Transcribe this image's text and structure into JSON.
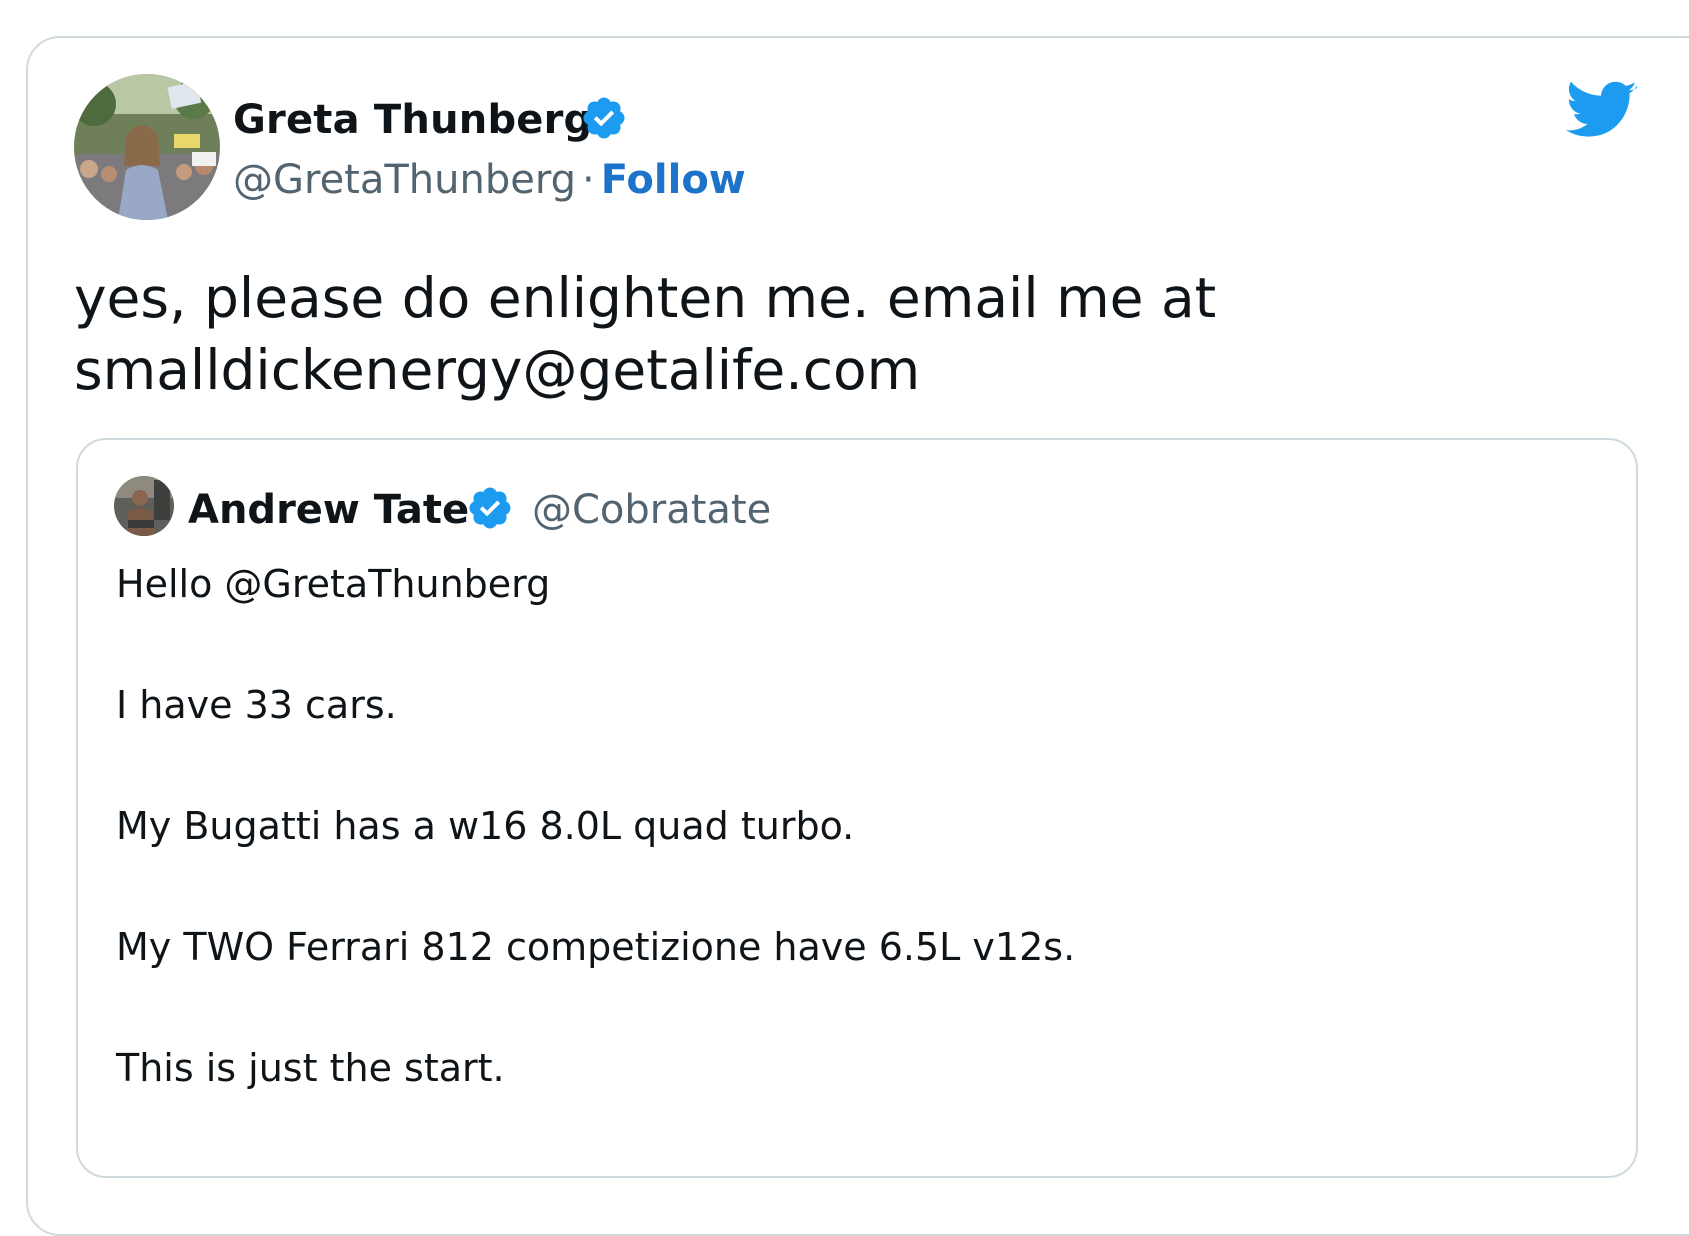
{
  "tweet": {
    "author_name": "Greta Thunberg",
    "author_handle": "@GretaThunberg",
    "separator": "·",
    "follow_label": "Follow",
    "verified": true,
    "text_lines": [
      "yes, please do enlighten me. email me at",
      "smalldickenergy@getalife.com"
    ],
    "brand_icon": "twitter-bird-icon",
    "brand_color": "#1d9bf0",
    "follow_color": "#1d72c9"
  },
  "quoted_tweet": {
    "author_name": "Andrew Tate",
    "author_handle": "@Cobratate",
    "verified": true,
    "paragraphs": [
      "Hello @GretaThunberg",
      "I have 33 cars.",
      "My Bugatti has a w16 8.0L quad turbo.",
      "My TWO Ferrari 812 competizione have 6.5L v12s.",
      "This is just the start."
    ]
  }
}
